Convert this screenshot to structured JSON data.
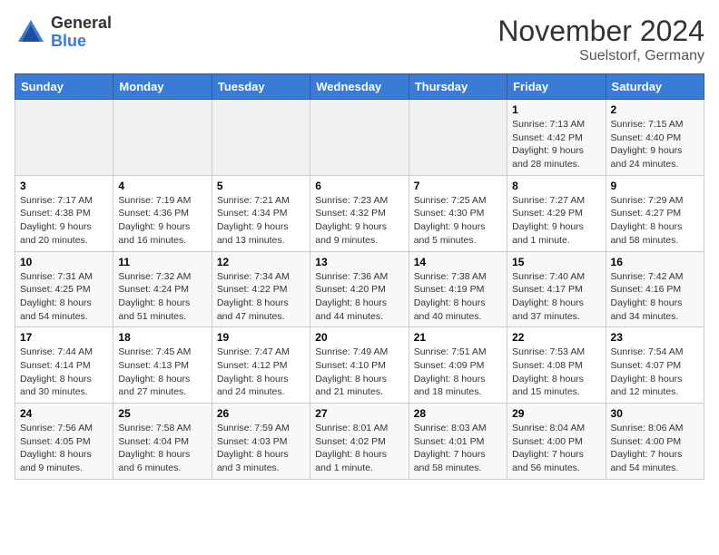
{
  "logo": {
    "general": "General",
    "blue": "Blue"
  },
  "title": "November 2024",
  "location": "Suelstorf, Germany",
  "days_of_week": [
    "Sunday",
    "Monday",
    "Tuesday",
    "Wednesday",
    "Thursday",
    "Friday",
    "Saturday"
  ],
  "weeks": [
    [
      {
        "day": "",
        "info": ""
      },
      {
        "day": "",
        "info": ""
      },
      {
        "day": "",
        "info": ""
      },
      {
        "day": "",
        "info": ""
      },
      {
        "day": "",
        "info": ""
      },
      {
        "day": "1",
        "info": "Sunrise: 7:13 AM\nSunset: 4:42 PM\nDaylight: 9 hours and 28 minutes."
      },
      {
        "day": "2",
        "info": "Sunrise: 7:15 AM\nSunset: 4:40 PM\nDaylight: 9 hours and 24 minutes."
      }
    ],
    [
      {
        "day": "3",
        "info": "Sunrise: 7:17 AM\nSunset: 4:38 PM\nDaylight: 9 hours and 20 minutes."
      },
      {
        "day": "4",
        "info": "Sunrise: 7:19 AM\nSunset: 4:36 PM\nDaylight: 9 hours and 16 minutes."
      },
      {
        "day": "5",
        "info": "Sunrise: 7:21 AM\nSunset: 4:34 PM\nDaylight: 9 hours and 13 minutes."
      },
      {
        "day": "6",
        "info": "Sunrise: 7:23 AM\nSunset: 4:32 PM\nDaylight: 9 hours and 9 minutes."
      },
      {
        "day": "7",
        "info": "Sunrise: 7:25 AM\nSunset: 4:30 PM\nDaylight: 9 hours and 5 minutes."
      },
      {
        "day": "8",
        "info": "Sunrise: 7:27 AM\nSunset: 4:29 PM\nDaylight: 9 hours and 1 minute."
      },
      {
        "day": "9",
        "info": "Sunrise: 7:29 AM\nSunset: 4:27 PM\nDaylight: 8 hours and 58 minutes."
      }
    ],
    [
      {
        "day": "10",
        "info": "Sunrise: 7:31 AM\nSunset: 4:25 PM\nDaylight: 8 hours and 54 minutes."
      },
      {
        "day": "11",
        "info": "Sunrise: 7:32 AM\nSunset: 4:24 PM\nDaylight: 8 hours and 51 minutes."
      },
      {
        "day": "12",
        "info": "Sunrise: 7:34 AM\nSunset: 4:22 PM\nDaylight: 8 hours and 47 minutes."
      },
      {
        "day": "13",
        "info": "Sunrise: 7:36 AM\nSunset: 4:20 PM\nDaylight: 8 hours and 44 minutes."
      },
      {
        "day": "14",
        "info": "Sunrise: 7:38 AM\nSunset: 4:19 PM\nDaylight: 8 hours and 40 minutes."
      },
      {
        "day": "15",
        "info": "Sunrise: 7:40 AM\nSunset: 4:17 PM\nDaylight: 8 hours and 37 minutes."
      },
      {
        "day": "16",
        "info": "Sunrise: 7:42 AM\nSunset: 4:16 PM\nDaylight: 8 hours and 34 minutes."
      }
    ],
    [
      {
        "day": "17",
        "info": "Sunrise: 7:44 AM\nSunset: 4:14 PM\nDaylight: 8 hours and 30 minutes."
      },
      {
        "day": "18",
        "info": "Sunrise: 7:45 AM\nSunset: 4:13 PM\nDaylight: 8 hours and 27 minutes."
      },
      {
        "day": "19",
        "info": "Sunrise: 7:47 AM\nSunset: 4:12 PM\nDaylight: 8 hours and 24 minutes."
      },
      {
        "day": "20",
        "info": "Sunrise: 7:49 AM\nSunset: 4:10 PM\nDaylight: 8 hours and 21 minutes."
      },
      {
        "day": "21",
        "info": "Sunrise: 7:51 AM\nSunset: 4:09 PM\nDaylight: 8 hours and 18 minutes."
      },
      {
        "day": "22",
        "info": "Sunrise: 7:53 AM\nSunset: 4:08 PM\nDaylight: 8 hours and 15 minutes."
      },
      {
        "day": "23",
        "info": "Sunrise: 7:54 AM\nSunset: 4:07 PM\nDaylight: 8 hours and 12 minutes."
      }
    ],
    [
      {
        "day": "24",
        "info": "Sunrise: 7:56 AM\nSunset: 4:05 PM\nDaylight: 8 hours and 9 minutes."
      },
      {
        "day": "25",
        "info": "Sunrise: 7:58 AM\nSunset: 4:04 PM\nDaylight: 8 hours and 6 minutes."
      },
      {
        "day": "26",
        "info": "Sunrise: 7:59 AM\nSunset: 4:03 PM\nDaylight: 8 hours and 3 minutes."
      },
      {
        "day": "27",
        "info": "Sunrise: 8:01 AM\nSunset: 4:02 PM\nDaylight: 8 hours and 1 minute."
      },
      {
        "day": "28",
        "info": "Sunrise: 8:03 AM\nSunset: 4:01 PM\nDaylight: 7 hours and 58 minutes."
      },
      {
        "day": "29",
        "info": "Sunrise: 8:04 AM\nSunset: 4:00 PM\nDaylight: 7 hours and 56 minutes."
      },
      {
        "day": "30",
        "info": "Sunrise: 8:06 AM\nSunset: 4:00 PM\nDaylight: 7 hours and 54 minutes."
      }
    ]
  ]
}
